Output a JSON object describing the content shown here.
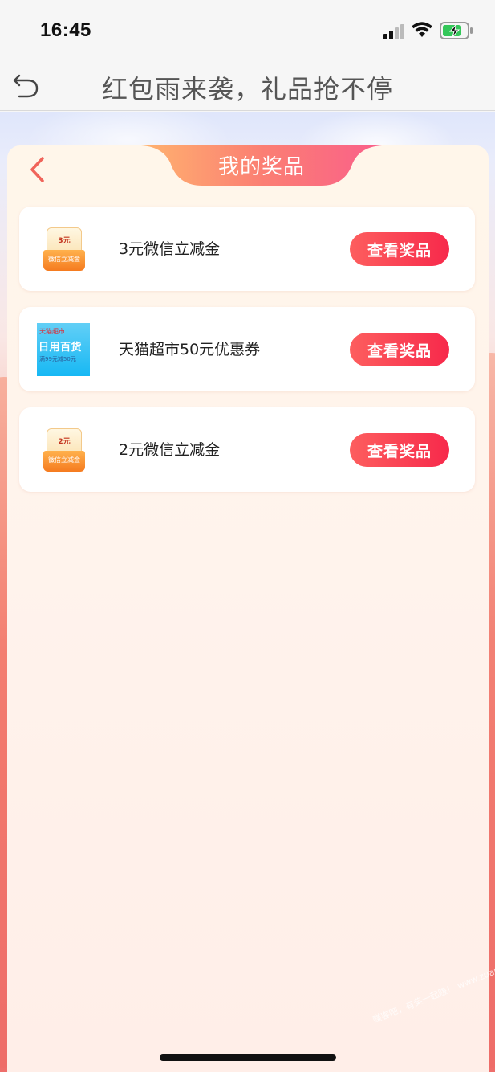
{
  "status_bar": {
    "time": "16:45",
    "icons": [
      "signal-icon",
      "wifi-icon",
      "battery-charging-icon"
    ]
  },
  "nav": {
    "back_icon": "undo-arrow-icon",
    "title": "红包雨来袭，礼品抢不停"
  },
  "panel": {
    "back_icon": "chevron-left-icon",
    "title": "我的奖品"
  },
  "prizes": [
    {
      "name": "3元微信立减金",
      "thumb": {
        "kind": "coin",
        "amount": "3元",
        "label": "微信立减金"
      },
      "button": "查看奖品"
    },
    {
      "name": "天猫超市50元优惠券",
      "thumb": {
        "kind": "tmall",
        "brand": "天猫超市",
        "main": "日用百货",
        "sub": "满99元减50元"
      },
      "button": "查看奖品"
    },
    {
      "name": "2元微信立减金",
      "thumb": {
        "kind": "coin",
        "amount": "2元",
        "label": "微信立减金"
      },
      "button": "查看奖品"
    }
  ],
  "watermark": "赚客吧，有奖一起赚！ www.zuanke8.com",
  "colors": {
    "accent": "#f7294b",
    "panel_header": "#fb7f73",
    "nav_bg": "#f6f6f6"
  }
}
